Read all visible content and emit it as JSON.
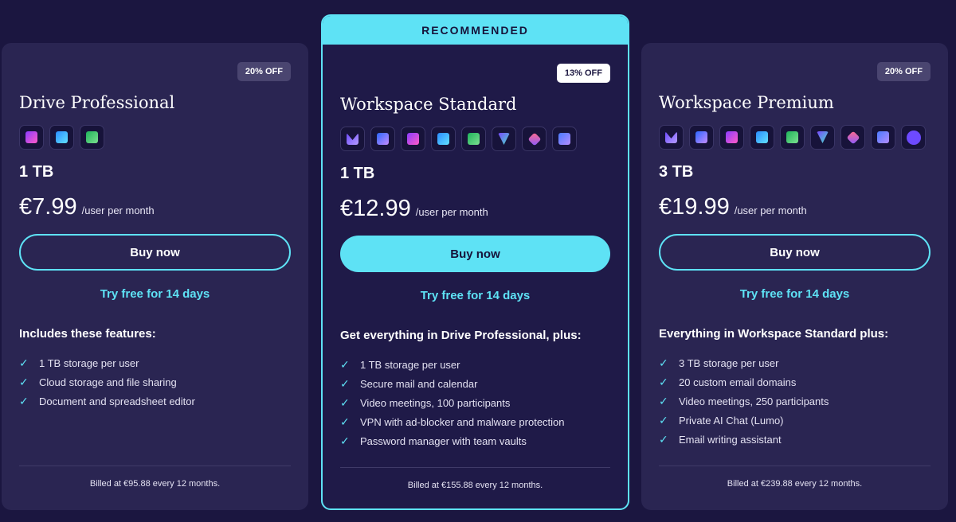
{
  "plans": [
    {
      "badge": "20% OFF",
      "title": "Drive Professional",
      "apps": [
        "drive-app-icon",
        "docs-app-icon",
        "sheets-app-icon"
      ],
      "storage": "1 TB",
      "price": "€7.99",
      "per": "/user per month",
      "cta": "Buy now",
      "trial": "Try free for 14 days",
      "features_title": "Includes these features:",
      "features": [
        "1 TB storage per user",
        "Cloud storage and file sharing",
        "Document and spreadsheet editor"
      ],
      "billed": "Billed at €95.88 every 12 months."
    },
    {
      "banner": "RECOMMENDED",
      "badge": "13% OFF",
      "title": "Workspace Standard",
      "apps": [
        "mail-app-icon",
        "calendar-app-icon",
        "drive-app-icon",
        "docs-app-icon",
        "sheets-app-icon",
        "vpn-app-icon",
        "pass-app-icon",
        "meet-app-icon"
      ],
      "storage": "1 TB",
      "price": "€12.99",
      "per": "/user per month",
      "cta": "Buy now",
      "trial": "Try free for 14 days",
      "features_title": "Get everything in Drive Professional, plus:",
      "features": [
        "1 TB storage per user",
        "Secure mail and calendar",
        "Video meetings, 100 participants",
        "VPN with ad-blocker and malware protection",
        "Password manager with team vaults"
      ],
      "billed": "Billed at €155.88 every 12 months."
    },
    {
      "badge": "20% OFF",
      "title": "Workspace Premium",
      "apps": [
        "mail-app-icon",
        "calendar-app-icon",
        "drive-app-icon",
        "docs-app-icon",
        "sheets-app-icon",
        "vpn-app-icon",
        "pass-app-icon",
        "meet-app-icon",
        "lumo-app-icon"
      ],
      "storage": "3 TB",
      "price": "€19.99",
      "per": "/user per month",
      "cta": "Buy now",
      "trial": "Try free for 14 days",
      "features_title": "Everything in Workspace Standard plus:",
      "features": [
        "3 TB storage per user",
        "20 custom email domains",
        "Video meetings, 250 participants",
        "Private AI Chat (Lumo)",
        "Email writing assistant"
      ],
      "billed": "Billed at €239.88 every 12 months."
    }
  ],
  "colors": {
    "accent": "#5ee2f5",
    "background": "#1b1640",
    "card": "#2a2552",
    "recommended_card": "#1f1a48"
  }
}
